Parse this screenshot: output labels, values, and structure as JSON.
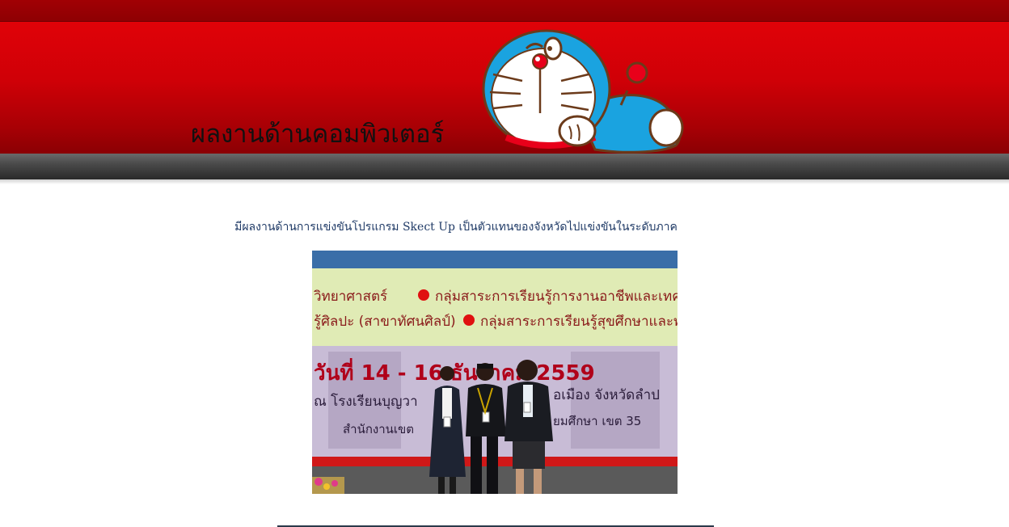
{
  "header": {
    "site_title": "ผลงานด้านคอมพิวเตอร์",
    "mascot_icon": "doraemon-mascot-icon",
    "colors": {
      "banner_red": "#d10007",
      "banner_dark_red": "#8e0003",
      "banner_gray": "#4a4a4a"
    }
  },
  "main": {
    "caption": "มีผลงานด้านการแข่งขันโปรแกรม Skect Up เป็นตัวแทนของจังหวัดไปแข่งขันในระดับภาค",
    "caption_color": "#1f3a66",
    "photo": {
      "banner_line1": "วิทยาศาสตร์",
      "banner_line2": "กลุ่มสาระการเรียนรู้การงานอาชีพและเทคโ",
      "banner_line3": "รู้ศิลปะ (สาขาทัศนศิลป์)",
      "banner_line4": "กลุ่มสาระการเรียนรู้สุขศึกษาและพ",
      "banner_date": "วันที่  14 - 16  ธันวาคม  2559",
      "banner_place": "ณ  โรงเรียนบุญวา",
      "banner_place2": "อเมือง  จังหวัดลำป",
      "banner_office": "สำนักงานเขต",
      "banner_office2": "ยมศึกษา  เขต  35"
    }
  }
}
